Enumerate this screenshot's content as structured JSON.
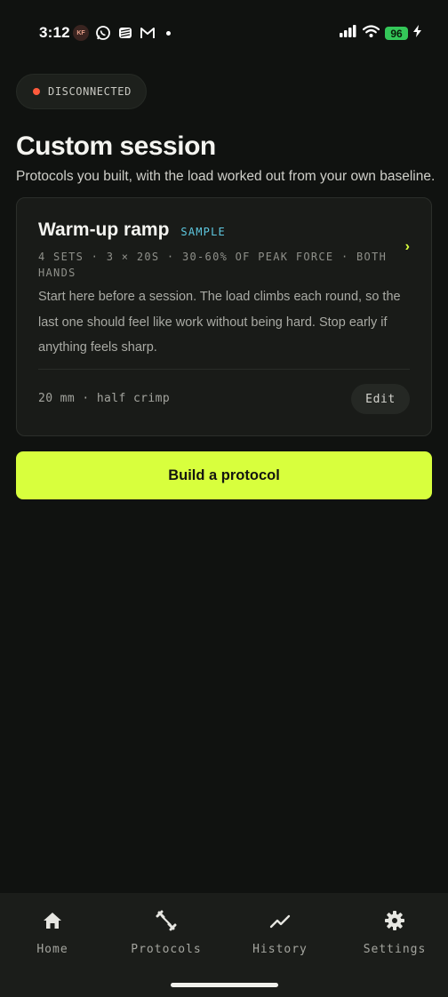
{
  "status_bar": {
    "time": "3:12",
    "avatar_initials": "KF",
    "battery": "96",
    "icons": [
      "whatsapp-icon",
      "stack-icon",
      "gmail-icon",
      "signal-icon",
      "wifi-icon",
      "charging-icon"
    ]
  },
  "connection": {
    "label": "DISCONNECTED",
    "color": "#ff5a3c"
  },
  "header": {
    "title": "Custom session",
    "subtitle": "Protocols you built, with the load worked out from your own baseline."
  },
  "protocol_card": {
    "title": "Warm-up ramp",
    "tag": "SAMPLE",
    "meta": "4 SETS · 3 × 20S · 30-60% OF PEAK FORCE · BOTH HANDS",
    "description": "Start here before a session. The load climbs each round, so the last one should feel like work without being hard. Stop early if anything feels sharp.",
    "footer": "20 mm · half crimp",
    "edit_label": "Edit",
    "chevron": "›"
  },
  "cta": {
    "label": "Build a protocol",
    "color": "#d8ff3d"
  },
  "tabs": [
    {
      "label": "Home",
      "icon": "home-icon"
    },
    {
      "label": "Protocols",
      "icon": "dumbbell-icon"
    },
    {
      "label": "History",
      "icon": "trend-icon"
    },
    {
      "label": "Settings",
      "icon": "gear-icon"
    }
  ]
}
